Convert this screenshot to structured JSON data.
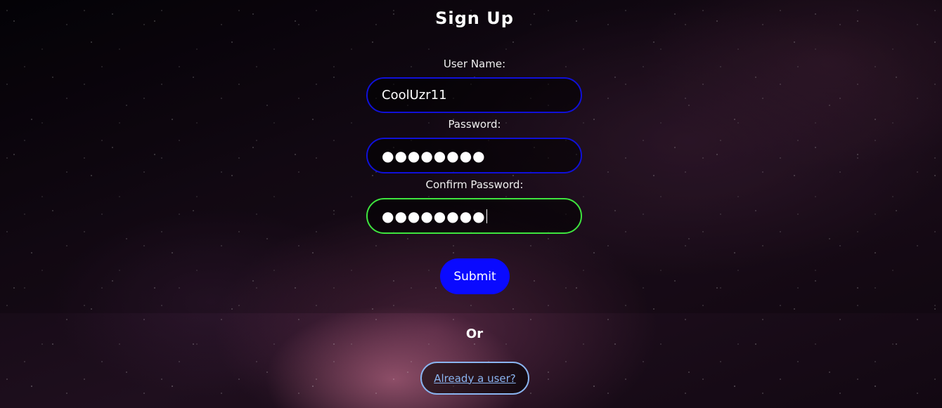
{
  "page": {
    "title": "Sign Up"
  },
  "form": {
    "username_label": "User Name:",
    "username_value": "CoolUzr11",
    "password_label": "Password:",
    "password_value": "●●●●●●●●",
    "confirm_label": "Confirm Password:",
    "confirm_value": "●●●●●●●●",
    "submit_label": "Submit"
  },
  "footer": {
    "or_text": "Or",
    "login_link": "Already a user?"
  },
  "colors": {
    "field_border": "#1010d8",
    "valid_border": "#3ee53e",
    "submit_bg": "#0a0aff",
    "link": "#8ab4f0"
  }
}
